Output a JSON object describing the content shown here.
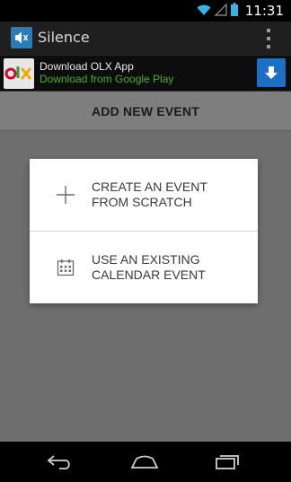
{
  "status_bar": {
    "time": "11:31"
  },
  "action_bar": {
    "title": "Silence",
    "icon": "speaker-mute-icon"
  },
  "ad": {
    "title": "Download OLX App",
    "subtitle": "Download from Google Play",
    "logo_text": "olx"
  },
  "screen": {
    "header": "ADD NEW EVENT"
  },
  "dialog": {
    "options": [
      {
        "label": "CREATE AN EVENT\nFROM SCRATCH",
        "icon": "plus-icon"
      },
      {
        "label": "USE AN EXISTING\nCALENDAR EVENT",
        "icon": "calendar-icon"
      }
    ]
  },
  "colors": {
    "background": "#6e6e6e",
    "header": "#7e7e7e",
    "dialog": "#ffffff",
    "app_icon": "#2a7bb8",
    "ad_subtitle": "#4caf2a",
    "ad_button": "#1d6fc6"
  }
}
